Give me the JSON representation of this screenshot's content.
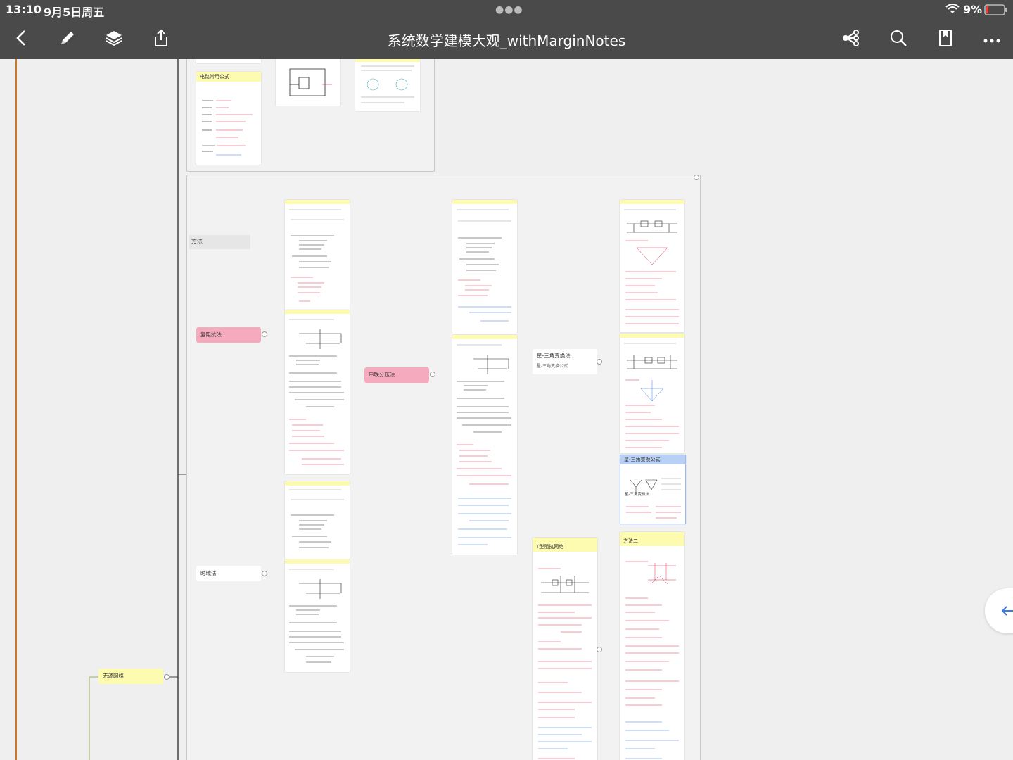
{
  "status": {
    "time": "13:10",
    "date": "9月5日周五",
    "battery": "9%"
  },
  "nav": {
    "title": "系统数学建模大观_withMarginNotes",
    "icons": [
      "back-chevron-icon",
      "pencil-icon",
      "layers-icon",
      "share-icon",
      "mindmap-icon",
      "search-icon",
      "bookmark-icon",
      "more-icon"
    ]
  },
  "mindmap": {
    "top_cards": {
      "formula_card_title": "电路常用公式"
    },
    "frame_label": "方法",
    "branches": {
      "complex": "复阻抗法",
      "series_divider": "串联分压法",
      "time_domain": "时域法",
      "passive": "无源网络"
    },
    "star_delta": {
      "label": "星-三角变换法",
      "sublabel": "星-三角变换公式"
    },
    "star_delta_card": {
      "title": "星-三角变换公式",
      "sublabel": "星-三角变换法"
    },
    "t_network_card": {
      "title": "T型阻抗网络"
    },
    "method2_card": {
      "title": "方法二"
    }
  },
  "colors": {
    "toolbar": "#4a4a4a",
    "canvas": "#efefef",
    "note_yellow": "#fdfbb0",
    "pink_node": "#f6aabd",
    "connector_green": "#b7c68b",
    "orange_line": "#c8782a",
    "blue_link": "#6d95d8"
  }
}
